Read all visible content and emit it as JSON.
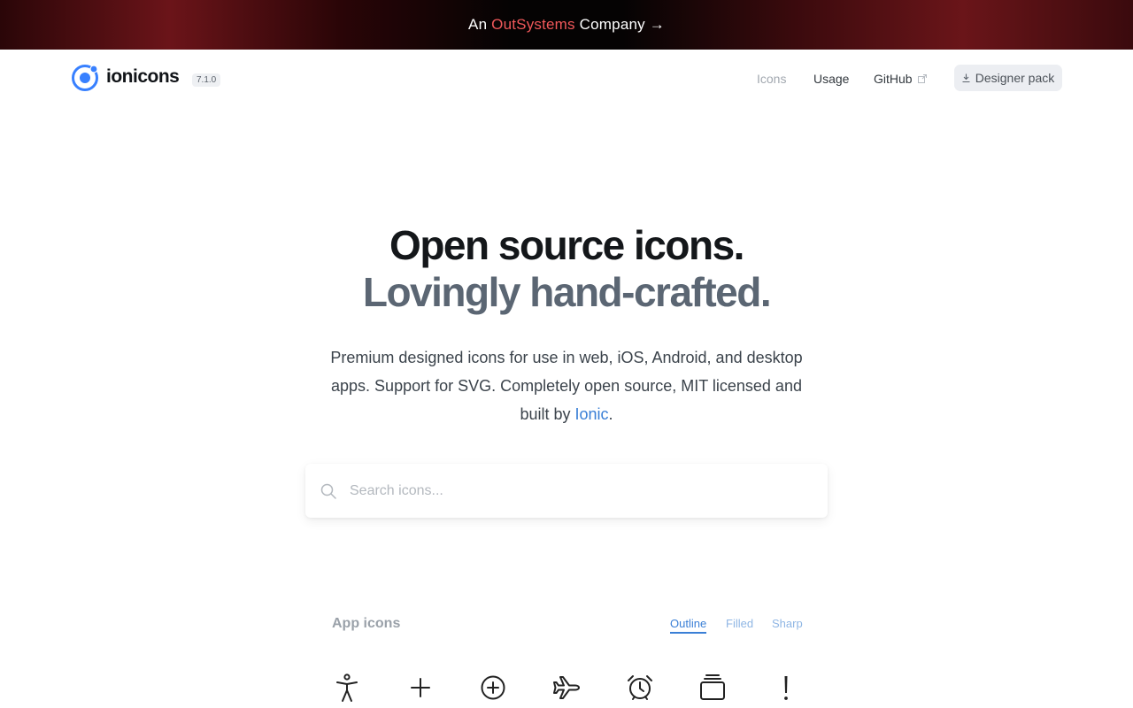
{
  "banner": {
    "prefix": "An ",
    "brand": "OutSystems",
    "suffix": " Company →"
  },
  "header": {
    "logo_text": "ionicons",
    "version": "7.1.0",
    "nav": {
      "icons": "Icons",
      "usage": "Usage",
      "github": "GitHub"
    },
    "designer_pack": "Designer pack"
  },
  "hero": {
    "line1": "Open source icons.",
    "line2": "Lovingly hand-crafted.",
    "subtitle_text": "Premium designed icons for use in web, iOS, Android, and desktop apps. Support for SVG. Completely open source, MIT licensed and built by ",
    "subtitle_link": "Ionic",
    "subtitle_end": "."
  },
  "search": {
    "placeholder": "Search icons..."
  },
  "app_icons": {
    "title": "App icons",
    "tabs": {
      "outline": "Outline",
      "filled": "Filled",
      "sharp": "Sharp"
    },
    "active_tab": "Outline",
    "icons": [
      "accessibility-icon",
      "add-icon",
      "add-circle-icon",
      "airplane-icon",
      "alarm-icon",
      "albums-icon",
      "alert-icon"
    ]
  },
  "colors": {
    "accent": "#3a7fd6",
    "brand_red": "#f0585a",
    "logo_blue": "#3880ff"
  }
}
